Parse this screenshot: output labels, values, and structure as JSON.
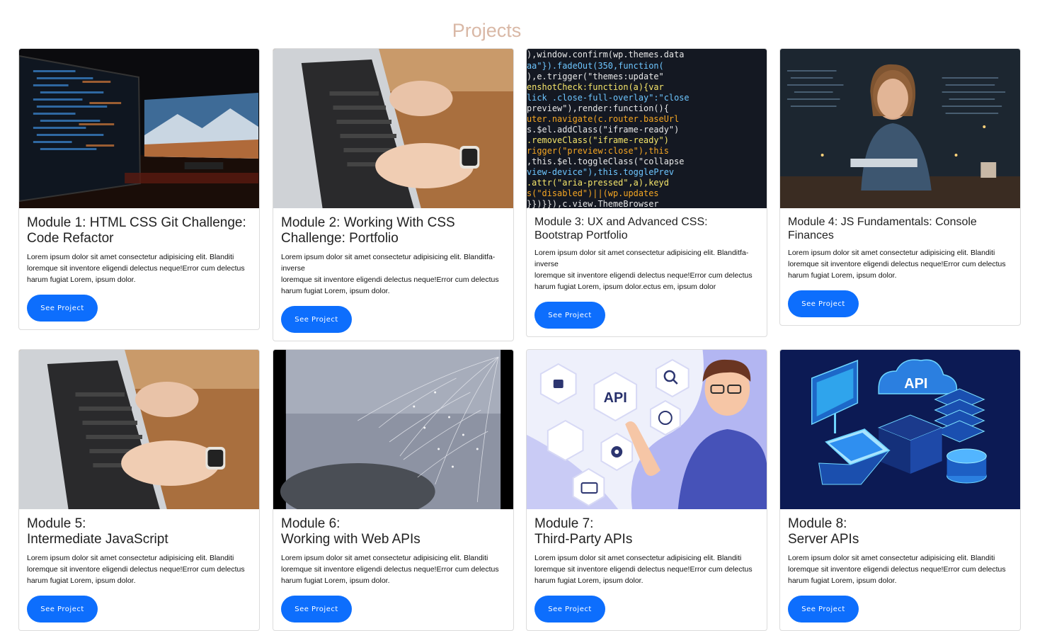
{
  "page": {
    "title": "Projects"
  },
  "cards": [
    {
      "title": "Module 1: HTML CSS Git Challenge: Code Refactor",
      "text": "Lorem ipsum dolor sit amet consectetur adipisicing elit. Blanditi loremque sit inventore eligendi delectus neque!Error cum delectus harum fugiat Lorem, ipsum dolor.",
      "button": "See Project",
      "image": "dual-monitor-setup"
    },
    {
      "title": "Module 2: Working With CSS Challenge: Portfolio",
      "text": "Lorem ipsum dolor sit amet consectetur adipisicing elit. Blanditfa-inverse\nloremque sit inventore eligendi delectus neque!Error cum delectus harum fugiat Lorem, ipsum dolor.",
      "button": "See Project",
      "image": "laptop-typing"
    },
    {
      "title": "Module 3: UX and Advanced CSS: Bootstrap Portfolio",
      "text": "Lorem ipsum dolor sit amet consectetur adipisicing elit. Blanditfa-inverse\nloremque sit inventore eligendi delectus neque!Error cum delectus harum fugiat Lorem, ipsum dolor.ectus em, ipsum dolor",
      "button": "See Project",
      "image": "code-closeup"
    },
    {
      "title": "Module 4: JS Fundamentals: Console Finances",
      "text": "Lorem ipsum dolor sit amet consectetur adipisicing elit. Blanditi loremque sit inventore eligendi delectus neque!Error cum delectus harum fugiat Lorem, ipsum dolor.",
      "button": "See Project",
      "image": "developer-woman"
    },
    {
      "title": "Module 5:\nIntermediate JavaScript",
      "text": "Lorem ipsum dolor sit amet consectetur adipisicing elit. Blanditi loremque sit inventore eligendi delectus neque!Error cum delectus harum fugiat Lorem, ipsum dolor.",
      "button": "See Project",
      "image": "laptop-typing"
    },
    {
      "title": "Module 6:\nWorking with Web APIs",
      "text": "Lorem ipsum dolor sit amet consectetur adipisicing elit. Blanditi loremque sit inventore eligendi delectus neque!Error cum delectus harum fugiat Lorem, ipsum dolor.",
      "button": "See Project",
      "image": "spider-web"
    },
    {
      "title": "Module 7:\nThird-Party APIs",
      "text": "Lorem ipsum dolor sit amet consectetur adipisicing elit. Blanditi loremque sit inventore eligendi delectus neque!Error cum delectus harum fugiat Lorem, ipsum dolor.",
      "button": "See Project",
      "image": "api-illustration",
      "image_label": "API"
    },
    {
      "title": "Module 8:\nServer APIs",
      "text": "Lorem ipsum dolor sit amet consectetur adipisicing elit. Blanditi loremque sit inventore eligendi delectus neque!Error cum delectus harum fugiat Lorem, ipsum dolor.",
      "button": "See Project",
      "image": "server-api-isometric",
      "image_label": "API"
    }
  ]
}
